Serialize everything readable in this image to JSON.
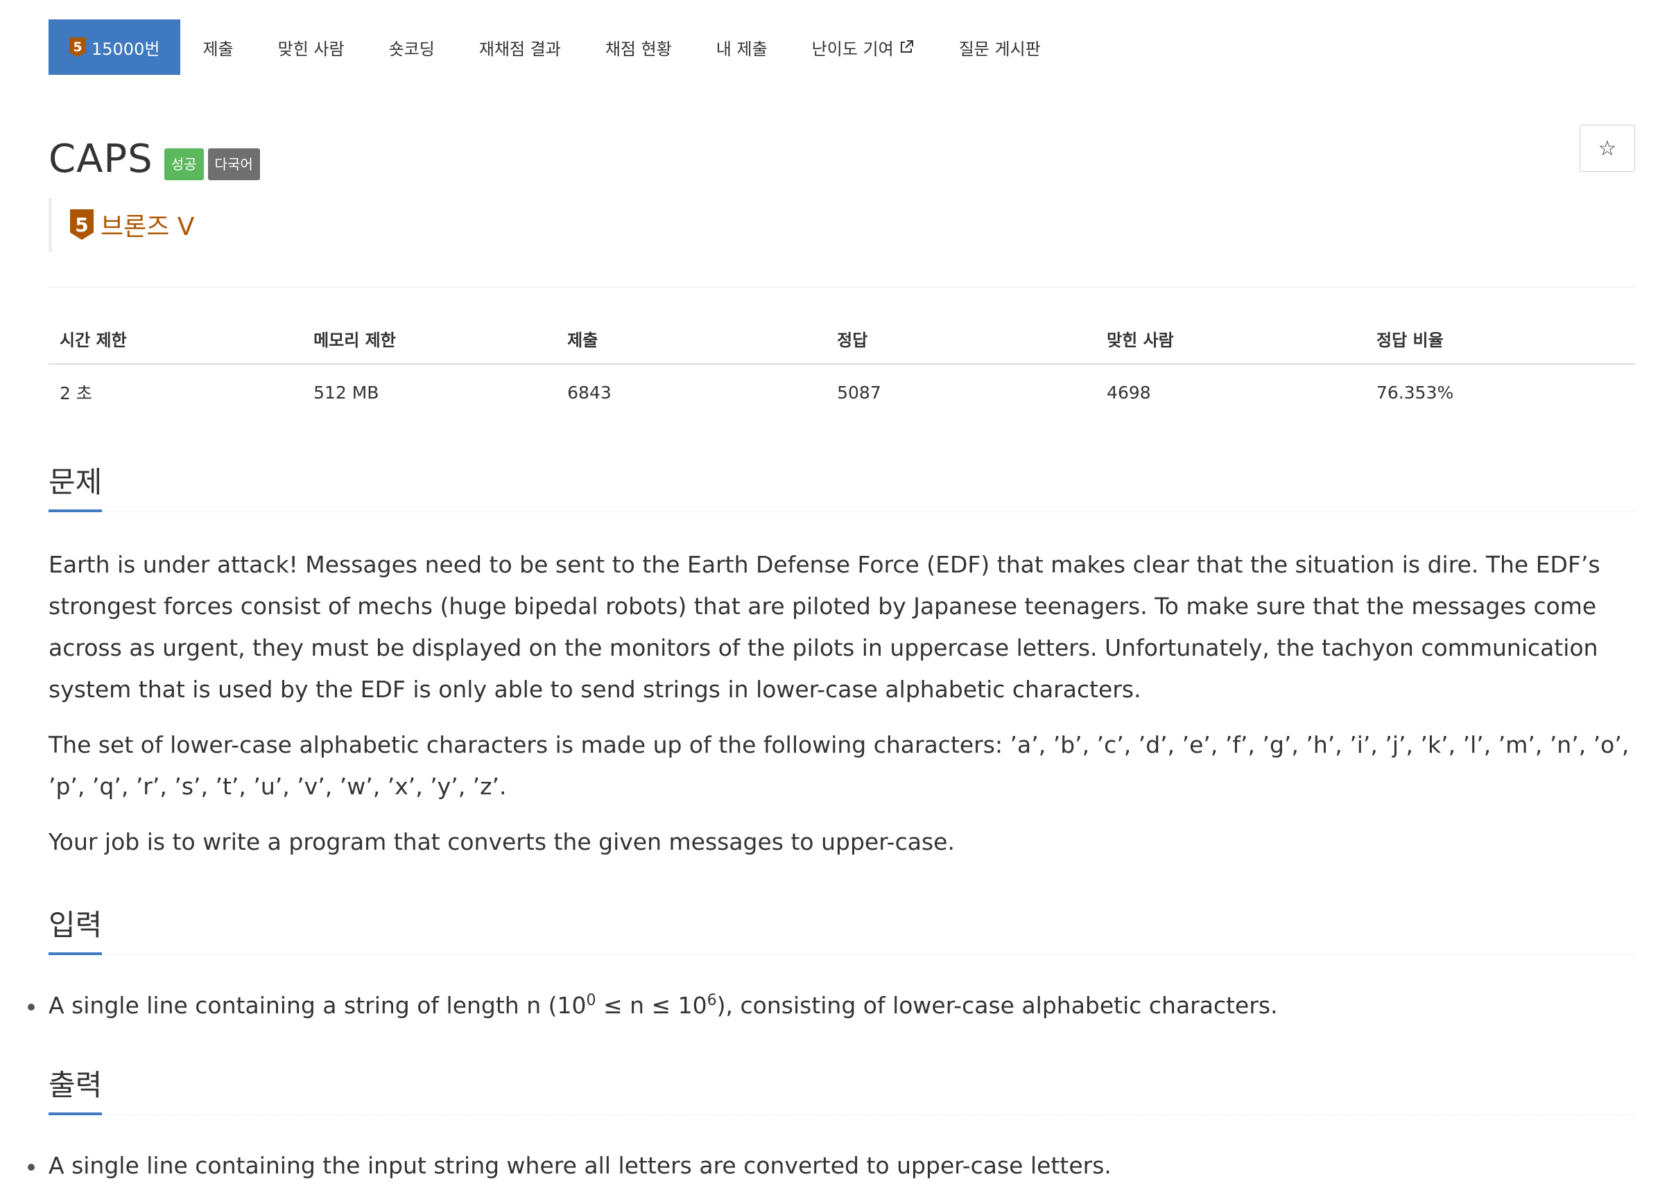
{
  "tabs": [
    {
      "label": "15000번",
      "active": true,
      "tier_mini": "5"
    },
    {
      "label": "제출"
    },
    {
      "label": "맞힌 사람"
    },
    {
      "label": "숏코딩"
    },
    {
      "label": "재채점 결과"
    },
    {
      "label": "채점 현황"
    },
    {
      "label": "내 제출"
    },
    {
      "label": "난이도 기여",
      "icon": "external-link-icon"
    },
    {
      "label": "질문 게시판"
    }
  ],
  "problem": {
    "title": "CAPS",
    "labels": {
      "success": "성공",
      "language": "다국어"
    },
    "star": "☆",
    "tier": {
      "number": "5",
      "name": "브론즈 V",
      "color": "#ad5600"
    }
  },
  "stats": {
    "headers": [
      "시간 제한",
      "메모리 제한",
      "제출",
      "정답",
      "맞힌 사람",
      "정답 비율"
    ],
    "values": [
      "2 초",
      "512 MB",
      "6843",
      "5087",
      "4698",
      "76.353%"
    ]
  },
  "sections": {
    "problem": {
      "title": "문제",
      "paragraphs": [
        "Earth is under attack! Messages need to be sent to the Earth Defense Force (EDF) that makes clear that the situation is dire. The EDF’s strongest forces consist of mechs (huge bipedal robots) that are piloted by Japanese teenagers. To make sure that the messages come across as urgent, they must be displayed on the monitors of the pilots in uppercase letters. Unfortunately, the tachyon communication system that is used by the EDF is only able to send strings in lower-case alphabetic characters.",
        "The set of lower-case alphabetic characters is made up of the following characters: ’a’, ’b’, ’c’, ’d’, ’e’, ’f’, ’g’, ’h’, ’i’, ’j’, ’k’, ’l’, ’m’, ’n’, ’o’, ’p’, ’q’, ’r’, ’s’, ’t’, ’u’, ’v’, ’w’, ’x’, ’y’, ’z’.",
        "Your job is to write a program that converts the given messages to upper-case."
      ]
    },
    "input": {
      "title": "입력",
      "item_before": "A single line containing a string of length n (10",
      "sup1": "0",
      "item_mid": " ≤ n ≤ 10",
      "sup2": "6",
      "item_after": "), consisting of lower-case alphabetic characters."
    },
    "output": {
      "title": "출력",
      "item": "A single line containing the input string where all letters are converted to upper-case letters."
    }
  },
  "colors": {
    "accent": "#3f7ac0",
    "success": "#5cb85c",
    "language_label": "#6f6f6f",
    "bronze": "#ad5600"
  }
}
